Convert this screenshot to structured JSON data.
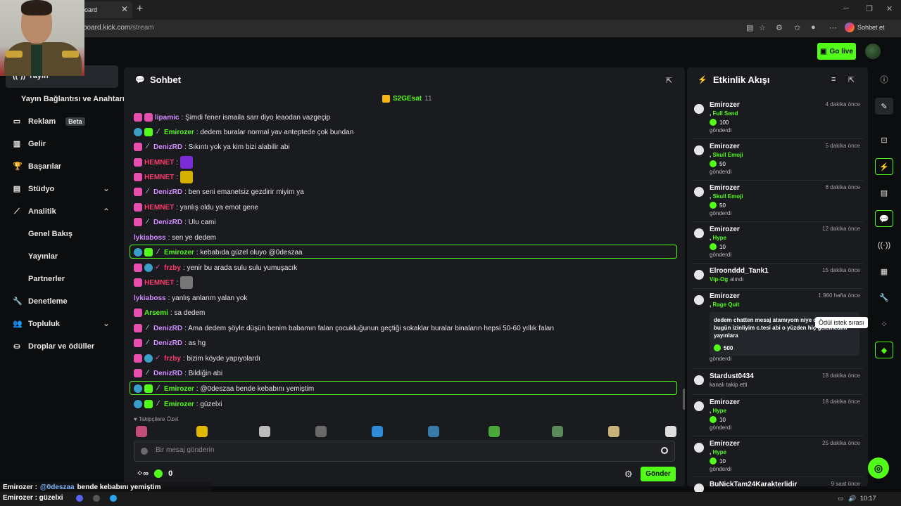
{
  "browser": {
    "tab_title": "oard",
    "url_host": "board.kick.com",
    "url_path": "/stream",
    "copilot_label": "Sohbet et"
  },
  "app": {
    "go_live": "Go live"
  },
  "sidebar": {
    "items": [
      {
        "label": "Yayın",
        "icon": "broadcast-icon"
      },
      {
        "label": "Yayın Bağlantısı ve Anahtarı",
        "icon": ""
      },
      {
        "label": "Reklam",
        "icon": "ad-icon",
        "badge": "Beta"
      },
      {
        "label": "Gelir",
        "icon": "revenue-icon"
      },
      {
        "label": "Başarılar",
        "icon": "trophy-icon"
      },
      {
        "label": "Stüdyo",
        "icon": "studio-icon",
        "expandable": true
      },
      {
        "label": "Analitik",
        "icon": "analytics-icon",
        "expanded": true
      },
      {
        "label": "Genel Bakış"
      },
      {
        "label": "Yayınlar"
      },
      {
        "label": "Partnerler"
      },
      {
        "label": "Denetleme",
        "icon": "moderation-icon"
      },
      {
        "label": "Topluluk",
        "icon": "community-icon",
        "expandable": true
      },
      {
        "label": "Droplar ve ödüller",
        "icon": "drops-icon"
      }
    ]
  },
  "chat": {
    "title": "Sohbet",
    "pinned_user": "S2GEsat",
    "pinned_count": "11",
    "messages": [
      {
        "user": "lipamic",
        "text": ": Şimdi fener ismaila sarr diyo leaodan vazgeçip",
        "color": "#d08cff"
      },
      {
        "user": "Emirozer",
        "text": ": dedem buralar normal yav anteptede çok bundan",
        "color": "#53fc18"
      },
      {
        "user": "DenizRD",
        "text": ": Sıkıntı yok ya kim bizi alabilir abi",
        "color": "#d08cff"
      },
      {
        "user": "HEMNET",
        "text": ":",
        "color": "#ff3a6e"
      },
      {
        "user": "HEMNET",
        "text": ":",
        "color": "#ff3a6e"
      },
      {
        "user": "DenizRD",
        "text": ": ben seni emanetsiz gezdirir miyim ya",
        "color": "#d08cff"
      },
      {
        "user": "HEMNET",
        "text": ": yanlış oldu ya emot gene",
        "color": "#ff3a6e"
      },
      {
        "user": "DenizRD",
        "text": ": Ulu cami",
        "color": "#d08cff"
      },
      {
        "user": "lykiaboss",
        "text": ": sen ye dedem",
        "color": "#d08cff"
      },
      {
        "user": "Emirozer",
        "text": ": kebabıda güzel oluyo @0deszaa",
        "color": "#53fc18"
      },
      {
        "user": "frzby",
        "text": ": yenir bu arada sulu sulu yumuşacık",
        "color": "#ff3a6e"
      },
      {
        "user": "HEMNET",
        "text": ":",
        "color": "#ff3a6e"
      },
      {
        "user": "lykiaboss",
        "text": ": yanlış anlarım yalan yok",
        "color": "#d08cff"
      },
      {
        "user": "Arsemi",
        "text": ": sa dedem",
        "color": "#53fc18"
      },
      {
        "user": "DenizRD",
        "text": ": Ama dedem şöyle düşün benim babamın falan çocukluğunun geçtiği sokaklar buralar binaların hepsi 50-60 yıllık falan",
        "color": "#d08cff"
      },
      {
        "user": "DenizRD",
        "text": ": as hg",
        "color": "#d08cff"
      },
      {
        "user": "frzby",
        "text": ": bizim köyde yapıyolardı",
        "color": "#ff3a6e"
      },
      {
        "user": "DenizRD",
        "text": ": Bildiğin abi",
        "color": "#d08cff"
      },
      {
        "user": "Emirozer",
        "text": ": @0deszaa bende kebabını yemiştim",
        "color": "#53fc18"
      },
      {
        "user": "Emirozer",
        "text": ": güzelxi",
        "color": "#53fc18"
      }
    ],
    "emote_section_label": "Takipçilere Özel",
    "input_placeholder": "Bir mesaj gönderin",
    "points_value": "0",
    "send_label": "Gönder"
  },
  "feed": {
    "title": "Etkinlik Akışı",
    "items": [
      {
        "name": "Emirozer",
        "time": "4 dakika önce",
        "gift": "Full Send",
        "amount": "100",
        "sent": "gönderdi"
      },
      {
        "name": "Emirozer",
        "time": "5 dakika önce",
        "gift": "Skull Emoji",
        "amount": "50",
        "sent": "gönderdi"
      },
      {
        "name": "Emirozer",
        "time": "8 dakika önce",
        "gift": "Skull Emoji",
        "amount": "50",
        "sent": "gönderdi"
      },
      {
        "name": "Emirozer",
        "time": "12 dakika önce",
        "gift": "Hype",
        "amount": "10",
        "sent": "gönderdi"
      },
      {
        "name": "Elroonddd_Tank1",
        "time": "15 dakika önce",
        "gift": "Vip-Og",
        "suffix": "alındı"
      },
      {
        "name": "Emirozer",
        "time": "1.960 hafta önce",
        "gift": "Rage Quit",
        "message": "dedem chatten mesaj atamıyom niye d çalışıyodum bugün izinliyim c.tesi abi o yüzden hiç gelemedim yayınlara",
        "amount": "500",
        "sent": "gönderdi"
      },
      {
        "name": "Stardust0434",
        "time": "18 dakika önce",
        "follow": "kanalı takip etti"
      },
      {
        "name": "Emirozer",
        "time": "18 dakika önce",
        "gift": "Hype",
        "amount": "10",
        "sent": "gönderdi"
      },
      {
        "name": "Emirozer",
        "time": "25 dakika önce",
        "gift": "Hype",
        "amount": "10",
        "sent": "gönderdi"
      },
      {
        "name": "BuNickTam24Karakterlidir",
        "time": "9 saat önce"
      }
    ],
    "tooltip": "Ödül istek sırası"
  },
  "overlay": {
    "line1_user": "Emirozer :",
    "line1_mention": "@0deszaa",
    "line1_text": "bende kebabını yemiştim",
    "line2": "Emirozer : güzelxi"
  },
  "taskbar": {
    "clock": "10:17"
  }
}
